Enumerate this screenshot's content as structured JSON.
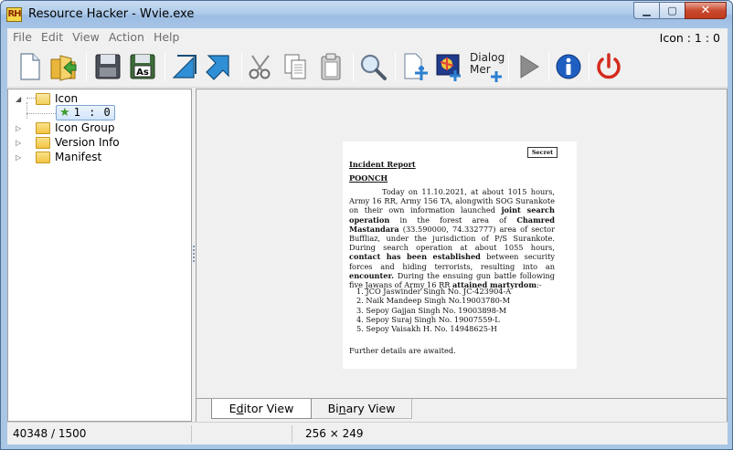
{
  "window": {
    "title": "Resource Hacker - Wvie.exe",
    "app_icon_text": "RH",
    "buttons": {
      "minimize": "▁",
      "maximize": "▢",
      "close": "✕"
    }
  },
  "menu": {
    "items": [
      "File",
      "Edit",
      "View",
      "Action",
      "Help"
    ],
    "status": "Icon : 1 : 0"
  },
  "toolbar": {
    "dialog_merge_label_1": "Dialog",
    "dialog_merge_label_2": "Mer",
    "icons": [
      "new-file-icon",
      "open-folder-icon",
      "save-icon",
      "save-as-icon",
      "compile-icon",
      "go-to-icon",
      "cut-icon",
      "copy-icon",
      "paste-icon",
      "search-icon",
      "add-resource-icon",
      "add-image-icon",
      "dialog-merger-icon",
      "run-icon",
      "info-icon",
      "exit-icon"
    ]
  },
  "tree": {
    "root": "Icon",
    "leaf": "1 : 0",
    "nodes": [
      "Icon Group",
      "Version Info",
      "Manifest"
    ]
  },
  "document": {
    "secret": "Secret",
    "title": "Incident Report",
    "place": "POONCH",
    "p1": "Today on 11.10.2021, at about 1015 hours, Army 16 RR, Army 156 TA, alongwith SOG Surankote on their own information launched ",
    "p1_bold1": "joint search operation",
    "p1b": " in the forest area of ",
    "p1_bold2": "Chamred Mastandara",
    "p1c": " (33.590000, 74.332777) area of sector Buffliaz, under the jurisdiction of P/S Surankote. During search operation at about 1055 hours, ",
    "p1_bold3": "contact has been established",
    "p1d": " between security forces and hiding terrorists, resulting into an ",
    "p1_bold4": "encounter.",
    "p1e": " During the ensuing gun battle following five Jawans of Army 16 RR ",
    "p1_bold5": "attained martyrdom",
    "p1f": ":-",
    "list": [
      "1. JCO Jaswinder Singh No. JC-423904-A",
      "2. Naik Mandeep Singh No.19003780-M",
      "3. Sepoy Gajjan Singh No. 19003898-M",
      "4. Sepoy Suraj Singh No. 19007559-L",
      "5. Sepoy Vaisakh H. No. 14948625-H"
    ],
    "footer": "Further details are awaited."
  },
  "tabs": {
    "editor_pre": "E",
    "editor_u": "d",
    "editor_post": "itor View",
    "binary_pre": "Bi",
    "binary_u": "n",
    "binary_post": "ary View"
  },
  "status": {
    "offset": "40348 / 1500",
    "dimensions": "256 × 249"
  },
  "colors": {
    "title_bar": "#aecbea",
    "close_button": "#c94a2e",
    "selection": "#d2e5fb"
  }
}
